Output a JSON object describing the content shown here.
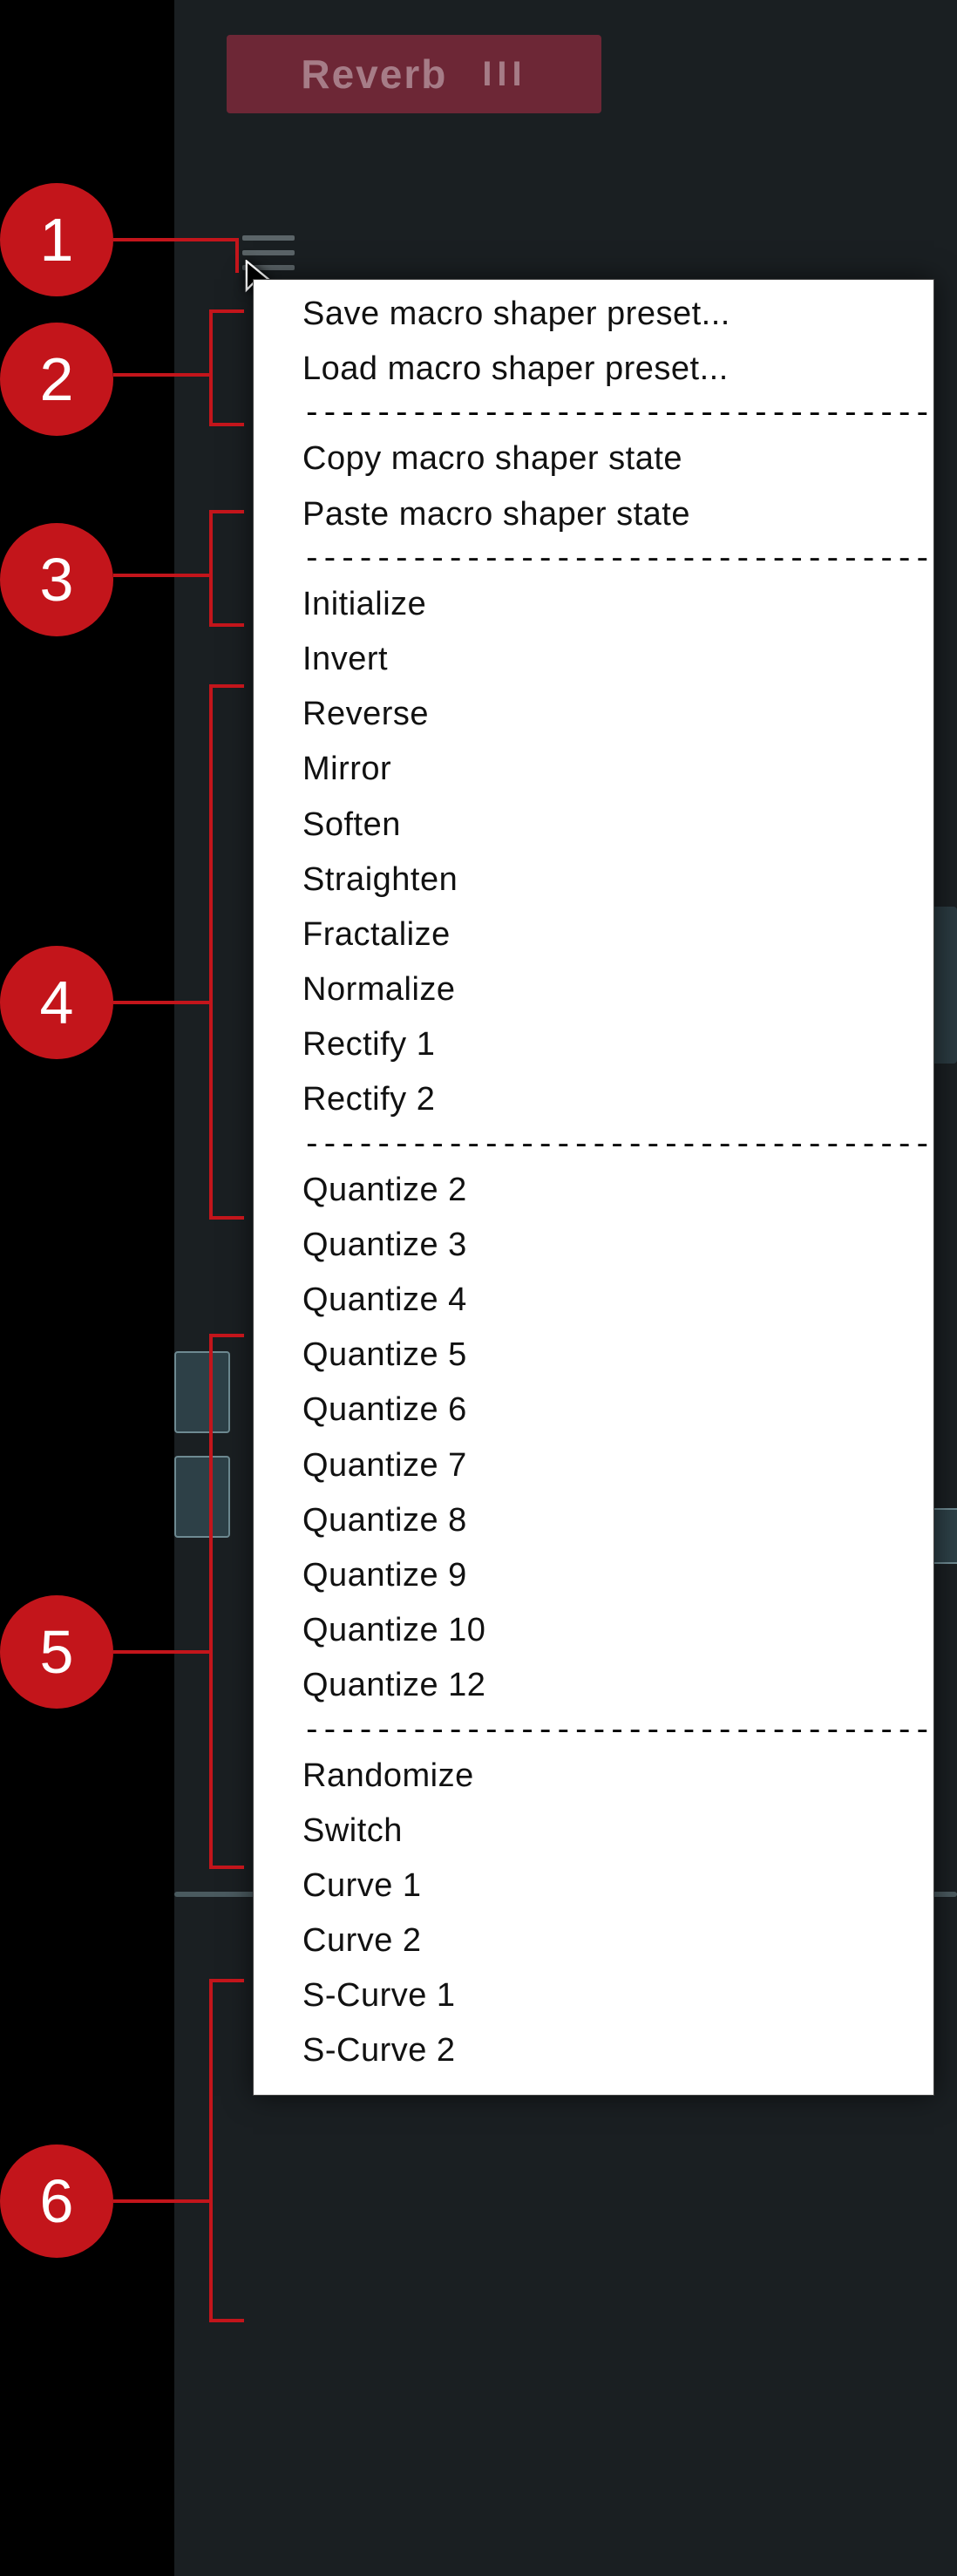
{
  "header": {
    "tab_label": "Reverb"
  },
  "callouts": [
    "1",
    "2",
    "3",
    "4",
    "5",
    "6"
  ],
  "sep": "--------------------------------------",
  "menu": {
    "group1": [
      "Save macro shaper preset...",
      "Load macro shaper preset..."
    ],
    "group2": [
      "Copy macro shaper state",
      "Paste macro shaper state"
    ],
    "group3": [
      "Initialize",
      "Invert",
      "Reverse",
      "Mirror",
      "Soften",
      "Straighten",
      "Fractalize",
      "Normalize",
      "Rectify 1",
      "Rectify 2"
    ],
    "group4": [
      "Quantize 2",
      "Quantize 3",
      "Quantize 4",
      "Quantize 5",
      "Quantize 6",
      "Quantize 7",
      "Quantize 8",
      "Quantize 9",
      "Quantize 10",
      "Quantize 12"
    ],
    "group5": [
      "Randomize",
      "Switch",
      "Curve 1",
      "Curve 2",
      "S-Curve 1",
      "S-Curve 2"
    ]
  }
}
